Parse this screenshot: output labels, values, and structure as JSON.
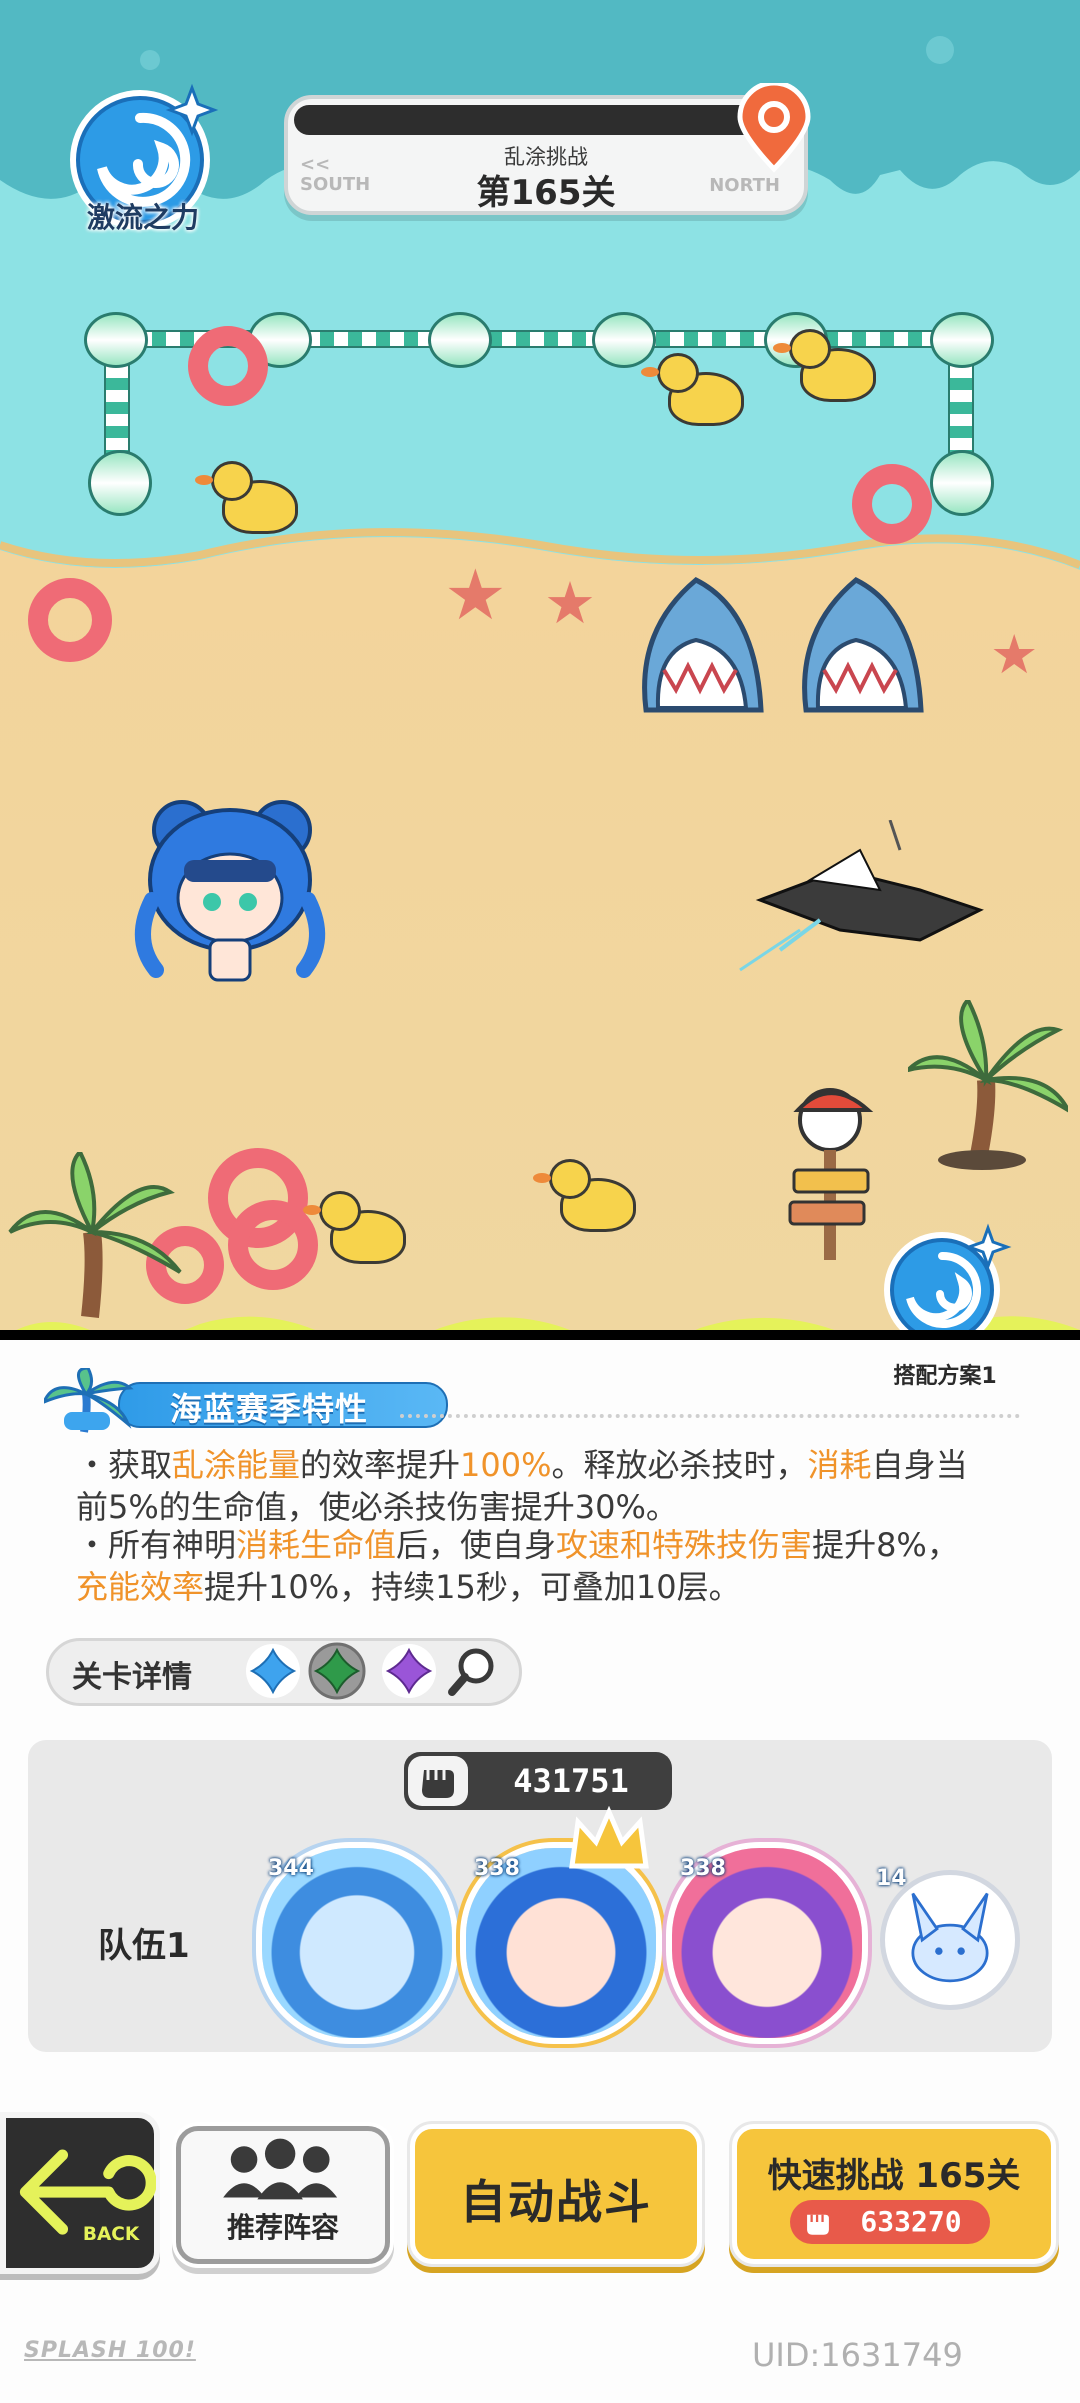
{
  "header": {
    "badge_label": "激流之力",
    "mode": "乱涂挑战",
    "level": "第165关",
    "dir_left_arrows": "<<",
    "dir_left": "SOUTH",
    "dir_right": "NORTH"
  },
  "scene": {
    "plan_label": "搭配方案1"
  },
  "season": {
    "title": "海蓝赛季特性",
    "line1_parts": [
      "・获取",
      "乱涂能量",
      "的效率提升",
      "100%",
      "。释放必杀技时，",
      "消耗",
      "自身当"
    ],
    "line2": "前5%的生命值，使必杀技伤害提升30%。",
    "line3_parts": [
      "・所有神明",
      "消耗生命值",
      "后，使自身",
      "攻速和特殊技伤害",
      "提升8%，"
    ],
    "line4_parts": [
      "充能效率",
      "提升10%，持续15秒，可叠加10层。"
    ]
  },
  "level_details": {
    "label": "关卡详情",
    "elements": [
      "blue-cross-icon",
      "green-cross-icon",
      "purple-cross-icon"
    ]
  },
  "team": {
    "power": "431751",
    "label": "队伍1",
    "members": [
      {
        "level": "344"
      },
      {
        "level": "338"
      },
      {
        "level": "338"
      }
    ],
    "pet_level": "14"
  },
  "buttons": {
    "back": "BACK",
    "recommend": "推荐阵容",
    "auto_battle": "自动战斗",
    "quick": "快速挑战 165关",
    "quick_cost": "633270"
  },
  "footer": {
    "logo": "SPLASH 100!",
    "uid": "UID:1631749"
  },
  "colors": {
    "highlight": "#f0932a",
    "button_yellow": "#f6c53c",
    "season_blue": "#2f9be8"
  }
}
